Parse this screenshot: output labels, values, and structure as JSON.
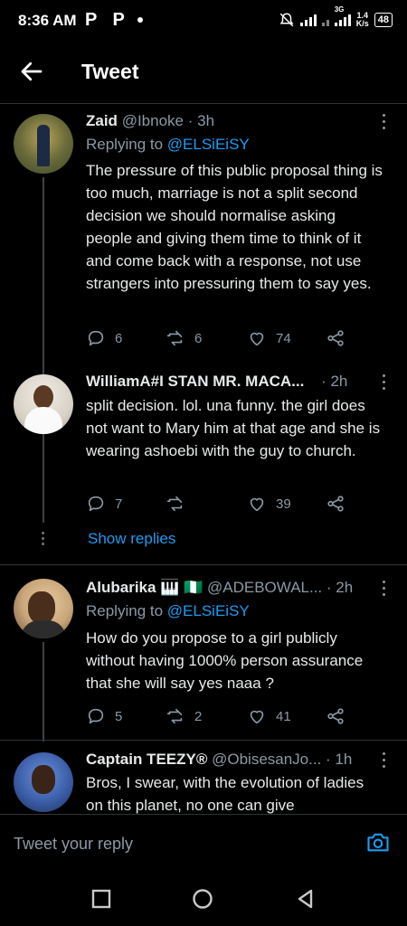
{
  "status_bar": {
    "time": "8:36 AM",
    "notification_icons": "P P",
    "net_type": "3G",
    "net_speed_value": "1.4",
    "net_speed_unit": "K/s",
    "battery": "48"
  },
  "header": {
    "title": "Tweet"
  },
  "tweets": [
    {
      "name": "Zaid",
      "handle": "@Ibnoke",
      "time": "· 3h",
      "replying_prefix": "Replying to",
      "replying_to": "@ELSiEiSY",
      "text": "The pressure of this public proposal thing is too much, marriage is not a split second decision we should normalise asking people and giving them time to think of it and come back with a response, not use strangers into pressuring them to say yes.",
      "replies": "6",
      "retweets": "6",
      "likes": "74"
    },
    {
      "name": "WilliamA#I STAN MR. MACA...",
      "time": "· 2h",
      "text": "split decision.  lol.  una funny.  the girl does not want to Mary him at that age and she is wearing ashoebi with the guy to church.",
      "replies": "7",
      "retweets": "",
      "likes": "39"
    },
    {
      "name": "Alubarika 🎹 🇳🇬",
      "handle": "@ADEBOWAL...",
      "time": "· 2h",
      "replying_prefix": "Replying to",
      "replying_to": "@ELSiEiSY",
      "text": "How do you propose to a girl publicly without having 1000% person assurance that she will say yes naaa ?",
      "replies": "5",
      "retweets": "2",
      "likes": "41"
    },
    {
      "name": "Captain TEEZY®",
      "handle": "@ObisesanJo...",
      "time": "· 1h",
      "text": "Bros, I swear, with the evolution of ladies on this planet, no one can give"
    }
  ],
  "show_replies": "Show replies",
  "reply_bar": {
    "placeholder": "Tweet your reply"
  },
  "colors": {
    "accent": "#1d9bf0",
    "background": "#000000",
    "muted": "#8b98a5"
  }
}
